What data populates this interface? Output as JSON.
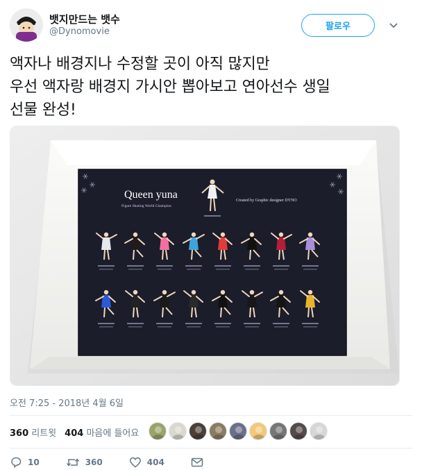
{
  "author": {
    "display_name": "뱃지만드는 뱃수",
    "handle": "@Dynomovie",
    "avatar_icon": "cartoon-avatar-icon"
  },
  "follow_label": "팔로우",
  "tweet": {
    "lines": [
      "액자나 배경지나 수정할 곳이 아직 많지만",
      "우선 액자랑 배경지 가시안 뽑아보고 연아선수 생일",
      "선물 완성!"
    ]
  },
  "media": {
    "title": "Queen yuna",
    "subtitle": "Figure Skating World Champion",
    "credit": "Created by Graphic designer DYNO",
    "frame_color": "#f4f4f2",
    "board_color": "#1b1d2b",
    "skater_colors_row1": [
      "#e7e7ee",
      "#231a1a",
      "#f46fa0",
      "#3fa4dc",
      "#e33a3a",
      "#111111",
      "#b21f3a",
      "#a88fd9"
    ],
    "skater_colors_row2": [
      "#2b59d8",
      "#222222",
      "#1a1a1a",
      "#2a2a2a",
      "#111111",
      "#171717",
      "#151515",
      "#e7b52b"
    ]
  },
  "timestamp": "오전 7:25 - 2018년 4월 6일",
  "stats": {
    "retweets_count": "360",
    "retweets_label": "리트윗",
    "likes_count": "404",
    "likes_label": "마음에 들어요"
  },
  "liker_colors": [
    "#9aa36a",
    "#dad7cf",
    "#4a4038",
    "#8b7b63",
    "#6c6f88",
    "#f1c978",
    "#767676",
    "#564b4b",
    "#d6d6d6"
  ],
  "actions": {
    "reply_count": "10",
    "retweet_count": "360",
    "like_count": "404"
  }
}
